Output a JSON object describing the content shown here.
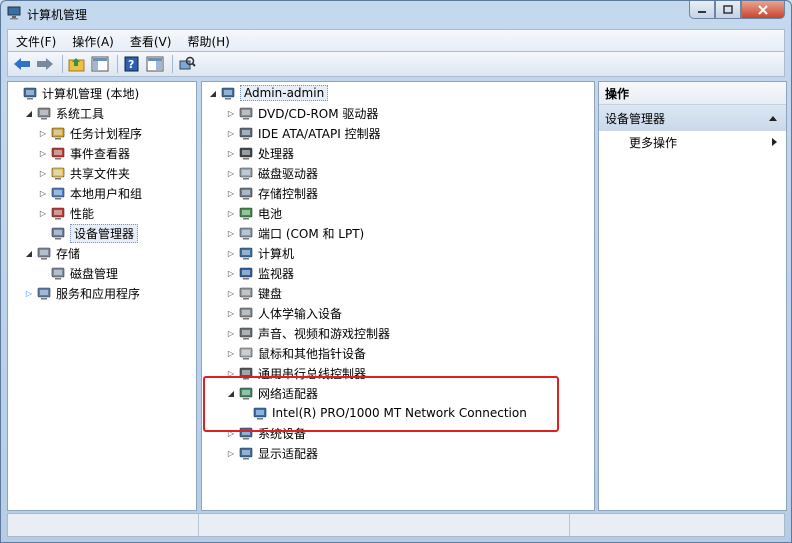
{
  "window": {
    "title": "计算机管理"
  },
  "menu": [
    "文件(F)",
    "操作(A)",
    "查看(V)",
    "帮助(H)"
  ],
  "left_tree": [
    {
      "label": "计算机管理 (本地)",
      "level": 0,
      "arrow": "",
      "icon": "computer-management-icon"
    },
    {
      "label": "系统工具",
      "level": 1,
      "arrow": "open",
      "icon": "tools-icon"
    },
    {
      "label": "任务计划程序",
      "level": 2,
      "arrow": "closed",
      "icon": "clock-icon"
    },
    {
      "label": "事件查看器",
      "level": 2,
      "arrow": "closed",
      "icon": "event-viewer-icon"
    },
    {
      "label": "共享文件夹",
      "level": 2,
      "arrow": "closed",
      "icon": "shared-folder-icon"
    },
    {
      "label": "本地用户和组",
      "level": 2,
      "arrow": "closed",
      "icon": "users-icon"
    },
    {
      "label": "性能",
      "level": 2,
      "arrow": "closed",
      "icon": "performance-icon"
    },
    {
      "label": "设备管理器",
      "level": 2,
      "arrow": "",
      "icon": "device-manager-icon",
      "selected": true
    },
    {
      "label": "存储",
      "level": 1,
      "arrow": "open",
      "icon": "storage-icon"
    },
    {
      "label": "磁盘管理",
      "level": 2,
      "arrow": "",
      "icon": "disk-management-icon"
    },
    {
      "label": "服务和应用程序",
      "level": 1,
      "arrow": "closed-blue",
      "icon": "services-icon"
    }
  ],
  "device_tree": {
    "root": "Admin-admin",
    "items": [
      {
        "label": "DVD/CD-ROM 驱动器",
        "icon": "dvd-drive-icon"
      },
      {
        "label": "IDE ATA/ATAPI 控制器",
        "icon": "ide-controller-icon"
      },
      {
        "label": "处理器",
        "icon": "processor-icon"
      },
      {
        "label": "磁盘驱动器",
        "icon": "disk-drive-icon"
      },
      {
        "label": "存储控制器",
        "icon": "storage-controller-icon"
      },
      {
        "label": "电池",
        "icon": "battery-icon"
      },
      {
        "label": "端口 (COM 和 LPT)",
        "icon": "port-icon"
      },
      {
        "label": "计算机",
        "icon": "computer-icon"
      },
      {
        "label": "监视器",
        "icon": "monitor-icon"
      },
      {
        "label": "键盘",
        "icon": "keyboard-icon"
      },
      {
        "label": "人体学输入设备",
        "icon": "hid-icon"
      },
      {
        "label": "声音、视频和游戏控制器",
        "icon": "sound-icon"
      },
      {
        "label": "鼠标和其他指针设备",
        "icon": "mouse-icon"
      },
      {
        "label": "通用串行总线控制器",
        "icon": "usb-icon"
      },
      {
        "label": "网络适配器",
        "icon": "network-adapter-icon",
        "expanded": true
      },
      {
        "label": "Intel(R) PRO/1000 MT Network Connection",
        "icon": "network-card-icon",
        "child": true
      },
      {
        "label": "系统设备",
        "icon": "system-device-icon"
      },
      {
        "label": "显示适配器",
        "icon": "display-adapter-icon"
      }
    ]
  },
  "actions": {
    "header": "操作",
    "section": "设备管理器",
    "more": "更多操作"
  },
  "colors": {
    "highlight": "#e02020",
    "section_bg": "#c9d8ea"
  }
}
